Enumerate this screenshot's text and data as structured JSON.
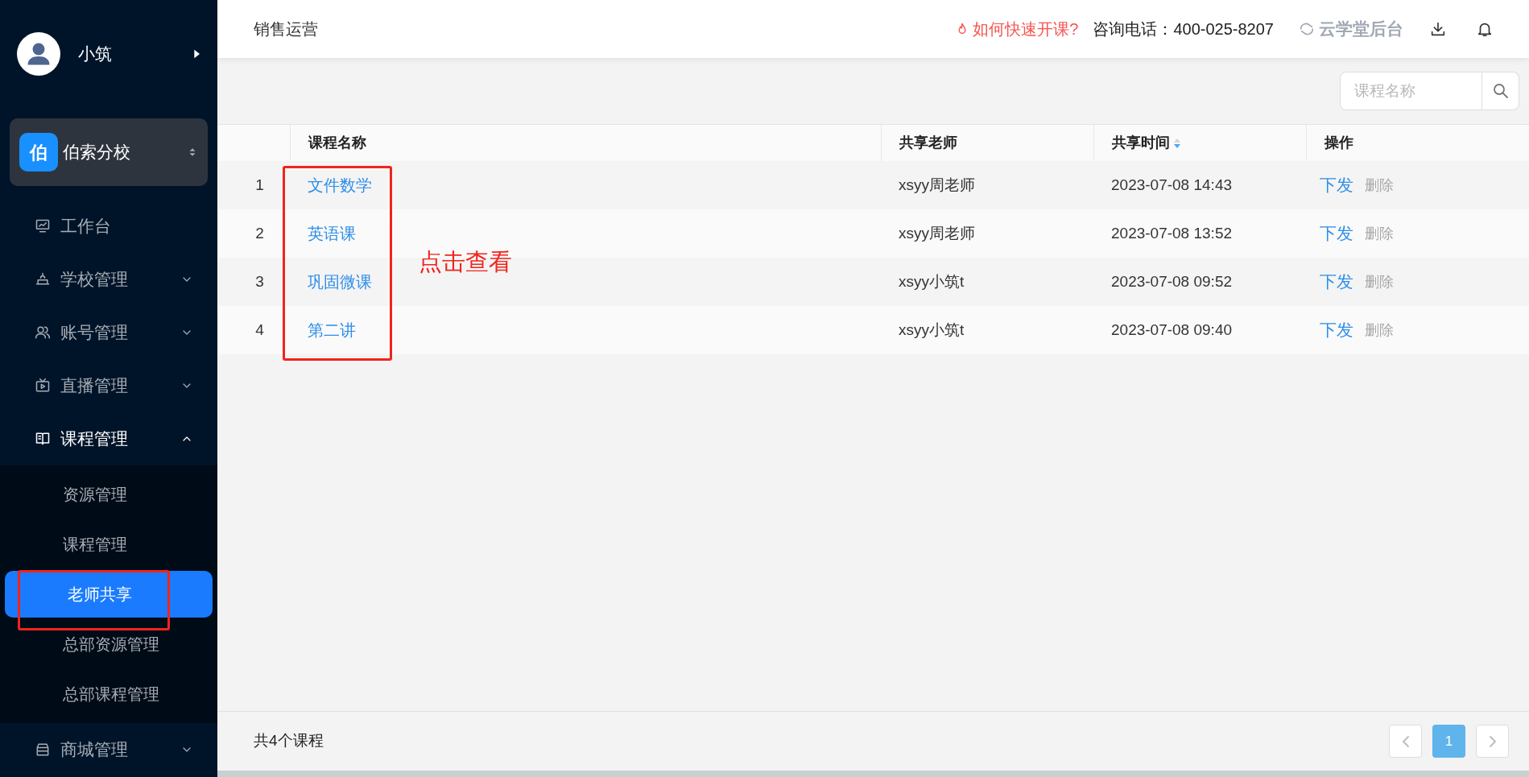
{
  "sidebar": {
    "user": {
      "name": "小筑"
    },
    "branch": {
      "badge": "伯",
      "name": "伯索分校"
    },
    "menu": [
      {
        "label": "工作台"
      },
      {
        "label": "学校管理",
        "expanded": false
      },
      {
        "label": "账号管理",
        "expanded": false
      },
      {
        "label": "直播管理",
        "expanded": false
      },
      {
        "label": "课程管理",
        "expanded": true,
        "children": [
          {
            "label": "资源管理",
            "selected": false
          },
          {
            "label": "课程管理",
            "selected": false
          },
          {
            "label": "老师共享",
            "selected": true
          },
          {
            "label": "总部资源管理",
            "selected": false
          },
          {
            "label": "总部课程管理",
            "selected": false
          }
        ]
      },
      {
        "label": "商城管理",
        "expanded": false
      }
    ]
  },
  "header": {
    "title": "销售运营",
    "help_link": "如何快速开课?",
    "phone": "咨询电话：400-025-8207",
    "backend_link": "云学堂后台"
  },
  "search": {
    "placeholder": "课程名称"
  },
  "table": {
    "columns": [
      {},
      {
        "label": "课程名称"
      },
      {
        "label": "共享老师"
      },
      {
        "label": "共享时间",
        "sort_descending": true
      },
      {
        "label": "操作"
      }
    ],
    "rows": [
      {
        "index": "1",
        "name": "文件数学",
        "teacher": "xsyy周老师",
        "time": "2023-07-08 14:43",
        "actions": [
          {
            "label": "下发",
            "disabled": false
          },
          {
            "label": "删除",
            "disabled": true
          }
        ]
      },
      {
        "index": "2",
        "name": "英语课",
        "teacher": "xsyy周老师",
        "time": "2023-07-08 13:52",
        "actions": [
          {
            "label": "下发",
            "disabled": false
          },
          {
            "label": "删除",
            "disabled": true
          }
        ]
      },
      {
        "index": "3",
        "name": "巩固微课",
        "teacher": "xsyy小筑t",
        "time": "2023-07-08 09:52",
        "actions": [
          {
            "label": "下发",
            "disabled": false
          },
          {
            "label": "删除",
            "disabled": true
          }
        ]
      },
      {
        "index": "4",
        "name": "第二讲",
        "teacher": "xsyy小筑t",
        "time": "2023-07-08 09:40",
        "actions": [
          {
            "label": "下发",
            "disabled": false
          },
          {
            "label": "删除",
            "disabled": true
          }
        ]
      }
    ]
  },
  "footer": {
    "total": "共4个课程",
    "pages": [
      {
        "label": "1",
        "selected": true
      }
    ]
  },
  "annotations": [
    {
      "kind": "box"
    },
    {
      "kind": "box"
    },
    {
      "kind": "text",
      "text": "点击查看"
    }
  ]
}
